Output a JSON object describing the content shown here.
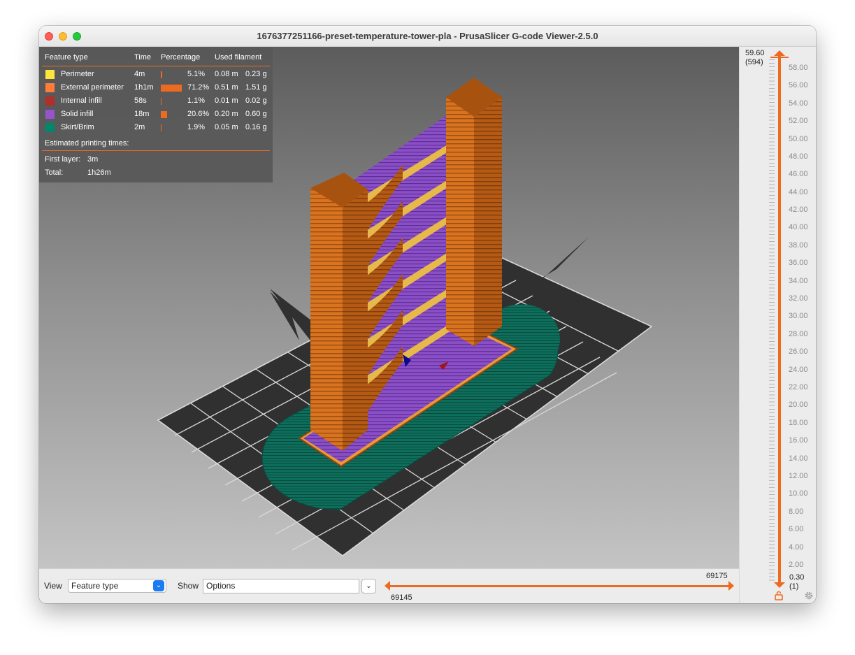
{
  "window": {
    "title": "1676377251166-preset-temperature-tower-pla - PrusaSlicer G-code Viewer-2.5.0"
  },
  "legend": {
    "headers": {
      "feature_type": "Feature type",
      "time": "Time",
      "percentage": "Percentage",
      "used_filament": "Used filament"
    },
    "rows": [
      {
        "name": "Perimeter",
        "time": "4m",
        "percentage": "5.1%",
        "share": 0.051,
        "meters": "0.08 m",
        "grams": "0.23 g",
        "color": "#ffe63c"
      },
      {
        "name": "External perimeter",
        "time": "1h1m",
        "percentage": "71.2%",
        "share": 0.712,
        "meters": "0.51 m",
        "grams": "1.51 g",
        "color": "#ff7d38"
      },
      {
        "name": "Internal infill",
        "time": "58s",
        "percentage": "1.1%",
        "share": 0.011,
        "meters": "0.01 m",
        "grams": "0.02 g",
        "color": "#b03029"
      },
      {
        "name": "Solid infill",
        "time": "18m",
        "percentage": "20.6%",
        "share": 0.206,
        "meters": "0.20 m",
        "grams": "0.60 g",
        "color": "#9654cc"
      },
      {
        "name": "Skirt/Brim",
        "time": "2m",
        "percentage": "1.9%",
        "share": 0.019,
        "meters": "0.05 m",
        "grams": "0.16 g",
        "color": "#00876e"
      }
    ],
    "estimated_label": "Estimated printing times:",
    "first_layer_label": "First layer:",
    "first_layer_value": "3m",
    "total_label": "Total:",
    "total_value": "1h26m"
  },
  "vertical_slider": {
    "top_value": "59.60",
    "top_layer": "(594)",
    "bottom_value": "0.30",
    "bottom_layer": "(1)",
    "ticks": [
      "58.00",
      "56.00",
      "54.00",
      "52.00",
      "50.00",
      "48.00",
      "46.00",
      "44.00",
      "42.00",
      "40.00",
      "38.00",
      "36.00",
      "34.00",
      "32.00",
      "30.00",
      "28.00",
      "26.00",
      "24.00",
      "22.00",
      "20.00",
      "18.00",
      "16.00",
      "14.00",
      "12.00",
      "10.00",
      "8.00",
      "6.00",
      "4.00",
      "2.00"
    ]
  },
  "bottom_bar": {
    "view_label": "View",
    "view_value": "Feature type",
    "show_label": "Show",
    "show_value": "Options",
    "horizontal_upper": "69175",
    "horizontal_lower": "69145"
  },
  "colors": {
    "accent": "#ed6b21",
    "selection_blue": "#1a7bf2"
  }
}
